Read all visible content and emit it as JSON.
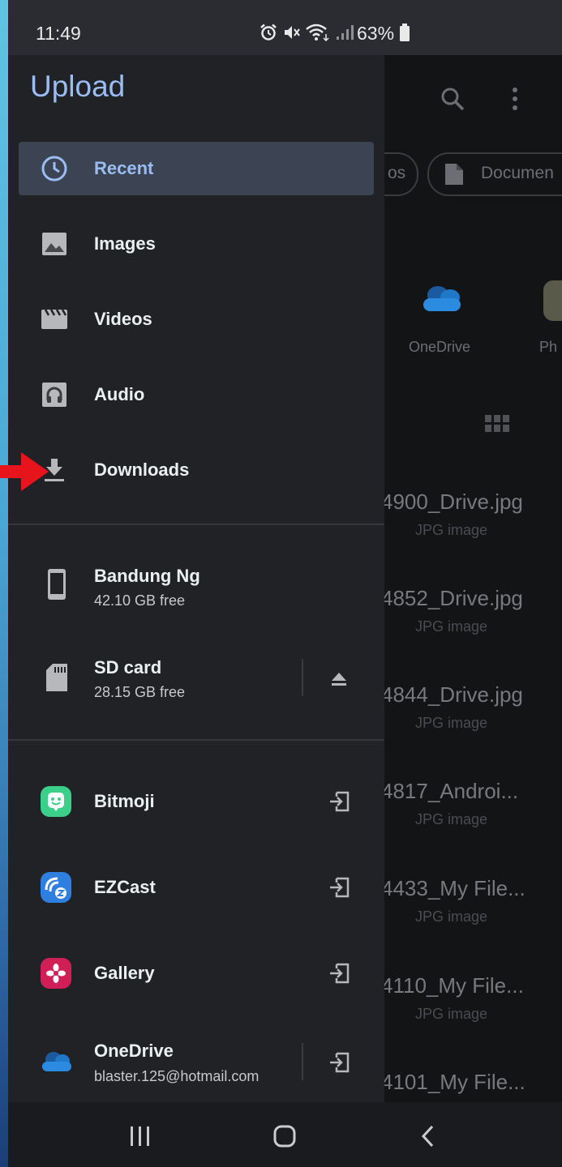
{
  "status_bar": {
    "time": "11:49",
    "battery": "63%"
  },
  "drawer": {
    "title": "Upload",
    "items": [
      {
        "label": "Recent",
        "icon": "clock-icon",
        "selected": true
      },
      {
        "label": "Images",
        "icon": "image-icon"
      },
      {
        "label": "Videos",
        "icon": "movie-icon"
      },
      {
        "label": "Audio",
        "icon": "headphones-icon"
      },
      {
        "label": "Downloads",
        "icon": "download-icon"
      }
    ],
    "storage": [
      {
        "name": "Bandung Ng",
        "free": "42.10 GB free",
        "icon": "phone-icon"
      },
      {
        "name": "SD card",
        "free": "28.15 GB free",
        "icon": "sd-card-icon"
      }
    ],
    "apps": [
      {
        "name": "Bitmoji"
      },
      {
        "name": "EZCast"
      },
      {
        "name": "Gallery"
      },
      {
        "name": "OneDrive",
        "account": "blaster.125@hotmail.com"
      }
    ]
  },
  "background": {
    "chips": [
      "os",
      "Documen"
    ],
    "sources": [
      {
        "label": "OneDrive"
      },
      {
        "label": "Ph"
      }
    ],
    "files": [
      {
        "name": "4900_Drive.jpg",
        "type": "JPG image"
      },
      {
        "name": "4852_Drive.jpg",
        "type": "JPG image"
      },
      {
        "name": "4844_Drive.jpg",
        "type": "JPG image"
      },
      {
        "name": "4817_Androi...",
        "type": "JPG image"
      },
      {
        "name": "4433_My File...",
        "type": "JPG image"
      },
      {
        "name": "4110_My File...",
        "type": "JPG image"
      },
      {
        "name": "4101_My File...",
        "type": "JPG image"
      }
    ]
  },
  "colors": {
    "accent": "#9bbdf3",
    "drawer_bg": "#212226",
    "selected_bg": "#3c4453",
    "annotation_arrow": "#e8141b"
  }
}
